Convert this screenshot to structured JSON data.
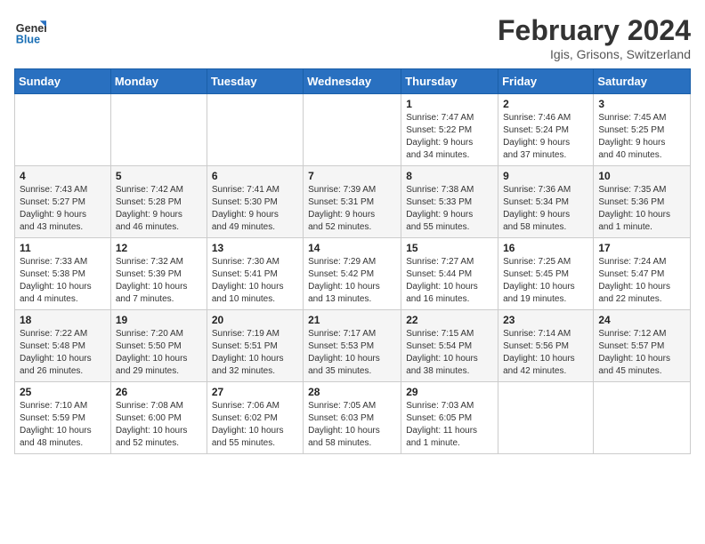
{
  "header": {
    "logo_text_general": "General",
    "logo_text_blue": "Blue",
    "month_year": "February 2024",
    "location": "Igis, Grisons, Switzerland"
  },
  "calendar": {
    "headers": [
      "Sunday",
      "Monday",
      "Tuesday",
      "Wednesday",
      "Thursday",
      "Friday",
      "Saturday"
    ],
    "weeks": [
      [
        {
          "day": "",
          "info": ""
        },
        {
          "day": "",
          "info": ""
        },
        {
          "day": "",
          "info": ""
        },
        {
          "day": "",
          "info": ""
        },
        {
          "day": "1",
          "info": "Sunrise: 7:47 AM\nSunset: 5:22 PM\nDaylight: 9 hours\nand 34 minutes."
        },
        {
          "day": "2",
          "info": "Sunrise: 7:46 AM\nSunset: 5:24 PM\nDaylight: 9 hours\nand 37 minutes."
        },
        {
          "day": "3",
          "info": "Sunrise: 7:45 AM\nSunset: 5:25 PM\nDaylight: 9 hours\nand 40 minutes."
        }
      ],
      [
        {
          "day": "4",
          "info": "Sunrise: 7:43 AM\nSunset: 5:27 PM\nDaylight: 9 hours\nand 43 minutes."
        },
        {
          "day": "5",
          "info": "Sunrise: 7:42 AM\nSunset: 5:28 PM\nDaylight: 9 hours\nand 46 minutes."
        },
        {
          "day": "6",
          "info": "Sunrise: 7:41 AM\nSunset: 5:30 PM\nDaylight: 9 hours\nand 49 minutes."
        },
        {
          "day": "7",
          "info": "Sunrise: 7:39 AM\nSunset: 5:31 PM\nDaylight: 9 hours\nand 52 minutes."
        },
        {
          "day": "8",
          "info": "Sunrise: 7:38 AM\nSunset: 5:33 PM\nDaylight: 9 hours\nand 55 minutes."
        },
        {
          "day": "9",
          "info": "Sunrise: 7:36 AM\nSunset: 5:34 PM\nDaylight: 9 hours\nand 58 minutes."
        },
        {
          "day": "10",
          "info": "Sunrise: 7:35 AM\nSunset: 5:36 PM\nDaylight: 10 hours\nand 1 minute."
        }
      ],
      [
        {
          "day": "11",
          "info": "Sunrise: 7:33 AM\nSunset: 5:38 PM\nDaylight: 10 hours\nand 4 minutes."
        },
        {
          "day": "12",
          "info": "Sunrise: 7:32 AM\nSunset: 5:39 PM\nDaylight: 10 hours\nand 7 minutes."
        },
        {
          "day": "13",
          "info": "Sunrise: 7:30 AM\nSunset: 5:41 PM\nDaylight: 10 hours\nand 10 minutes."
        },
        {
          "day": "14",
          "info": "Sunrise: 7:29 AM\nSunset: 5:42 PM\nDaylight: 10 hours\nand 13 minutes."
        },
        {
          "day": "15",
          "info": "Sunrise: 7:27 AM\nSunset: 5:44 PM\nDaylight: 10 hours\nand 16 minutes."
        },
        {
          "day": "16",
          "info": "Sunrise: 7:25 AM\nSunset: 5:45 PM\nDaylight: 10 hours\nand 19 minutes."
        },
        {
          "day": "17",
          "info": "Sunrise: 7:24 AM\nSunset: 5:47 PM\nDaylight: 10 hours\nand 22 minutes."
        }
      ],
      [
        {
          "day": "18",
          "info": "Sunrise: 7:22 AM\nSunset: 5:48 PM\nDaylight: 10 hours\nand 26 minutes."
        },
        {
          "day": "19",
          "info": "Sunrise: 7:20 AM\nSunset: 5:50 PM\nDaylight: 10 hours\nand 29 minutes."
        },
        {
          "day": "20",
          "info": "Sunrise: 7:19 AM\nSunset: 5:51 PM\nDaylight: 10 hours\nand 32 minutes."
        },
        {
          "day": "21",
          "info": "Sunrise: 7:17 AM\nSunset: 5:53 PM\nDaylight: 10 hours\nand 35 minutes."
        },
        {
          "day": "22",
          "info": "Sunrise: 7:15 AM\nSunset: 5:54 PM\nDaylight: 10 hours\nand 38 minutes."
        },
        {
          "day": "23",
          "info": "Sunrise: 7:14 AM\nSunset: 5:56 PM\nDaylight: 10 hours\nand 42 minutes."
        },
        {
          "day": "24",
          "info": "Sunrise: 7:12 AM\nSunset: 5:57 PM\nDaylight: 10 hours\nand 45 minutes."
        }
      ],
      [
        {
          "day": "25",
          "info": "Sunrise: 7:10 AM\nSunset: 5:59 PM\nDaylight: 10 hours\nand 48 minutes."
        },
        {
          "day": "26",
          "info": "Sunrise: 7:08 AM\nSunset: 6:00 PM\nDaylight: 10 hours\nand 52 minutes."
        },
        {
          "day": "27",
          "info": "Sunrise: 7:06 AM\nSunset: 6:02 PM\nDaylight: 10 hours\nand 55 minutes."
        },
        {
          "day": "28",
          "info": "Sunrise: 7:05 AM\nSunset: 6:03 PM\nDaylight: 10 hours\nand 58 minutes."
        },
        {
          "day": "29",
          "info": "Sunrise: 7:03 AM\nSunset: 6:05 PM\nDaylight: 11 hours\nand 1 minute."
        },
        {
          "day": "",
          "info": ""
        },
        {
          "day": "",
          "info": ""
        }
      ]
    ]
  }
}
